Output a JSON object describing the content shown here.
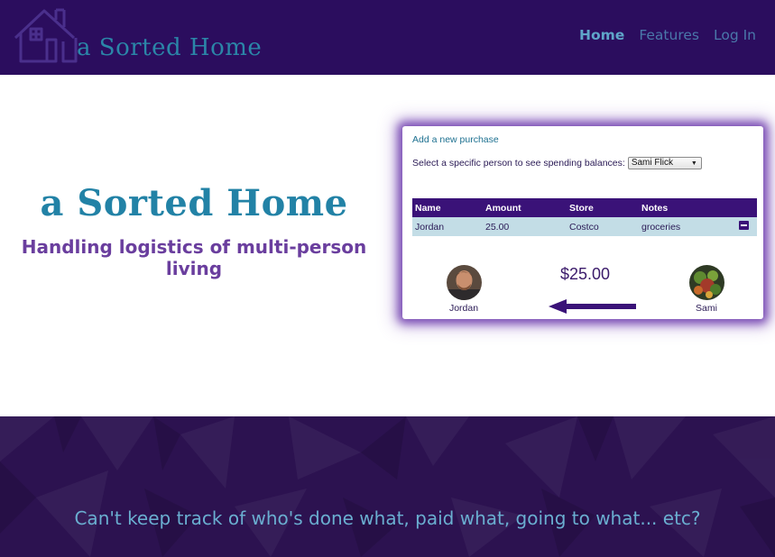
{
  "brand": {
    "name": "a Sorted Home"
  },
  "nav": [
    {
      "label": "Home",
      "active": true
    },
    {
      "label": "Features",
      "active": false
    },
    {
      "label": "Log In",
      "active": false
    }
  ],
  "hero": {
    "title": "a Sorted Home",
    "subtitle": "Handling logistics of multi-person living"
  },
  "preview": {
    "add_link": "Add a new purchase",
    "select_label": "Select a specific person to see spending balances:",
    "select_value": "Sami Flick",
    "table": {
      "headers": [
        "Name",
        "Amount",
        "Store",
        "Notes",
        ""
      ],
      "rows": [
        {
          "name": "Jordan",
          "amount": "25.00",
          "store": "Costco",
          "notes": "groceries"
        }
      ]
    },
    "balance": {
      "amount": "$25.00",
      "from": "Jordan",
      "to": "Sami",
      "direction_icon": "left-arrow-icon"
    }
  },
  "band": {
    "tagline": "Can't keep track of who's done what, paid what, going to what... etc?"
  },
  "colors": {
    "header_bg": "#2b0d5e",
    "brand_teal": "#2282a6",
    "accent_purple": "#3a1278",
    "subtitle_purple": "#6a3e9e",
    "band_bg": "#2c1250",
    "tagline_blue": "#6aaed0"
  }
}
